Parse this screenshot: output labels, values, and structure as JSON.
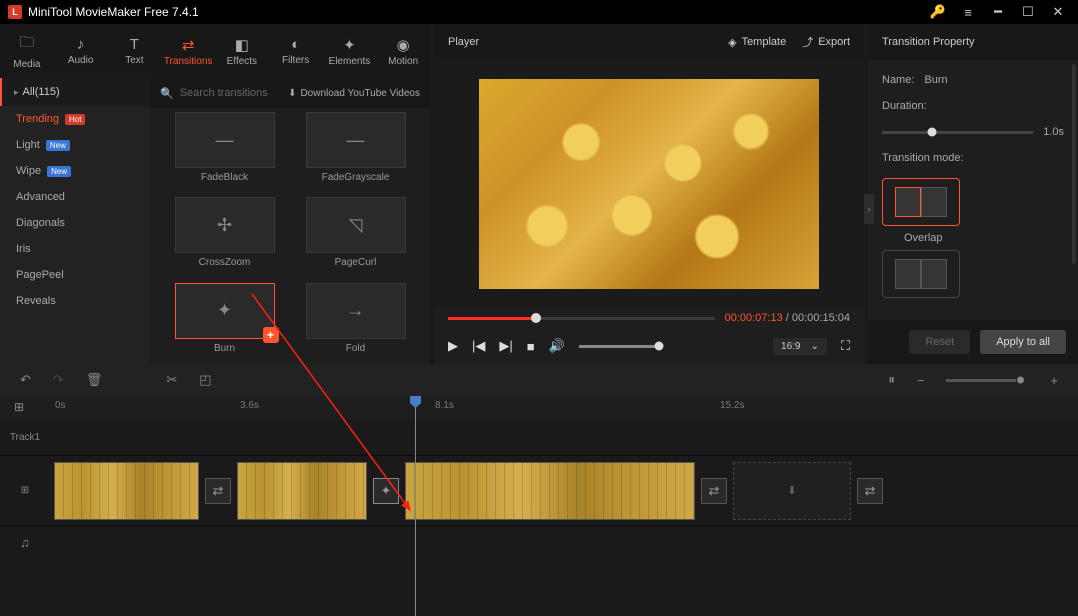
{
  "app": {
    "title": "MiniTool MovieMaker Free 7.4.1"
  },
  "tabs": [
    {
      "id": "media",
      "label": "Media",
      "icon": "🗀"
    },
    {
      "id": "audio",
      "label": "Audio",
      "icon": "♪"
    },
    {
      "id": "text",
      "label": "Text",
      "icon": "T"
    },
    {
      "id": "transitions",
      "label": "Transitions",
      "icon": "⇄",
      "active": true
    },
    {
      "id": "effects",
      "label": "Effects",
      "icon": "◧"
    },
    {
      "id": "filters",
      "label": "Filters",
      "icon": "◐"
    },
    {
      "id": "elements",
      "label": "Elements",
      "icon": "✦"
    },
    {
      "id": "motion",
      "label": "Motion",
      "icon": "◉"
    }
  ],
  "categories": {
    "header": "All(115)",
    "items": [
      {
        "label": "Trending",
        "badge": "Hot",
        "badgeClass": "hot",
        "active": true
      },
      {
        "label": "Light",
        "badge": "New",
        "badgeClass": "new"
      },
      {
        "label": "Wipe",
        "badge": "New",
        "badgeClass": "new"
      },
      {
        "label": "Advanced"
      },
      {
        "label": "Diagonals"
      },
      {
        "label": "Iris"
      },
      {
        "label": "PagePeel"
      },
      {
        "label": "Reveals"
      }
    ]
  },
  "search": {
    "placeholder": "Search transitions"
  },
  "download_label": "Download YouTube Videos",
  "transitions": [
    {
      "label": "FadeBlack"
    },
    {
      "label": "FadeGrayscale"
    },
    {
      "label": "CrossZoom"
    },
    {
      "label": "PageCurl"
    },
    {
      "label": "Burn",
      "selected": true,
      "add": true
    },
    {
      "label": "Fold"
    }
  ],
  "player": {
    "title": "Player",
    "template_label": "Template",
    "export_label": "Export",
    "current": "00:00:07:13",
    "total": "00:00:15:04",
    "ratio": "16:9"
  },
  "props": {
    "title": "Transition Property",
    "name_label": "Name:",
    "name_value": "Burn",
    "duration_label": "Duration:",
    "duration_value": "1.0s",
    "mode_label": "Transition mode:",
    "overlap_label": "Overlap",
    "reset": "Reset",
    "apply_all": "Apply to all"
  },
  "timeline": {
    "ticks": [
      {
        "label": "0s",
        "pos": 55
      },
      {
        "label": "3.6s",
        "pos": 240
      },
      {
        "label": "8.1s",
        "pos": 435
      },
      {
        "label": "15.2s",
        "pos": 720
      }
    ],
    "track_label": "Track1"
  }
}
